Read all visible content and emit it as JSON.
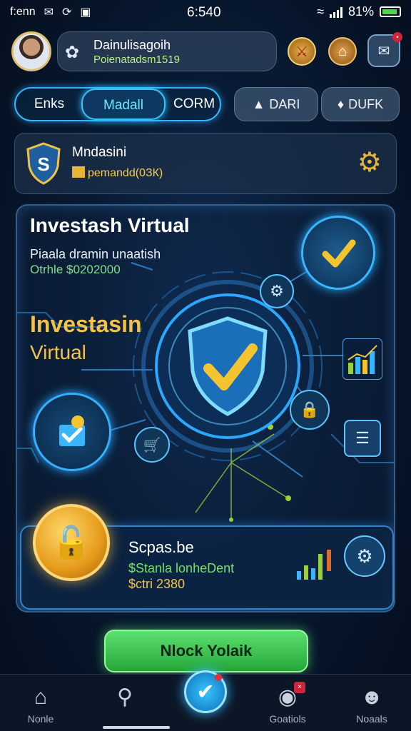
{
  "status_bar": {
    "left_text": "f:enn",
    "time": "6:540",
    "battery_text": "81%"
  },
  "header": {
    "user_name": "Dainulisagoih",
    "user_sub": "Poienatadsm1519"
  },
  "tabs": {
    "group": [
      "Enks",
      "Madall",
      "CORM"
    ],
    "active": "Madall",
    "pills": [
      "DARI",
      "DUFK"
    ]
  },
  "info_card": {
    "title": "Mndasini",
    "subtitle": "pemandd(0ЗК)"
  },
  "main_panel": {
    "title": "Investash Virtual",
    "line1": "Piaala dramin unaatish",
    "line2": "Otrhle $0202000",
    "big_title_1": "Investasin",
    "big_title_2": "Virtual"
  },
  "sub_card": {
    "title": "Scpas.be",
    "line1": "$Stanla lonheDent",
    "line2": "$ctri 2380"
  },
  "cta": {
    "label": "Nlock Yolaik"
  },
  "bottom_nav": {
    "home": "Nonle",
    "camera": "Goatiols",
    "profile": "Noaals"
  },
  "colors": {
    "accent_blue": "#2fb7ff",
    "gold": "#f2c24a",
    "green": "#5ee070",
    "alert_red": "#d0243a"
  }
}
